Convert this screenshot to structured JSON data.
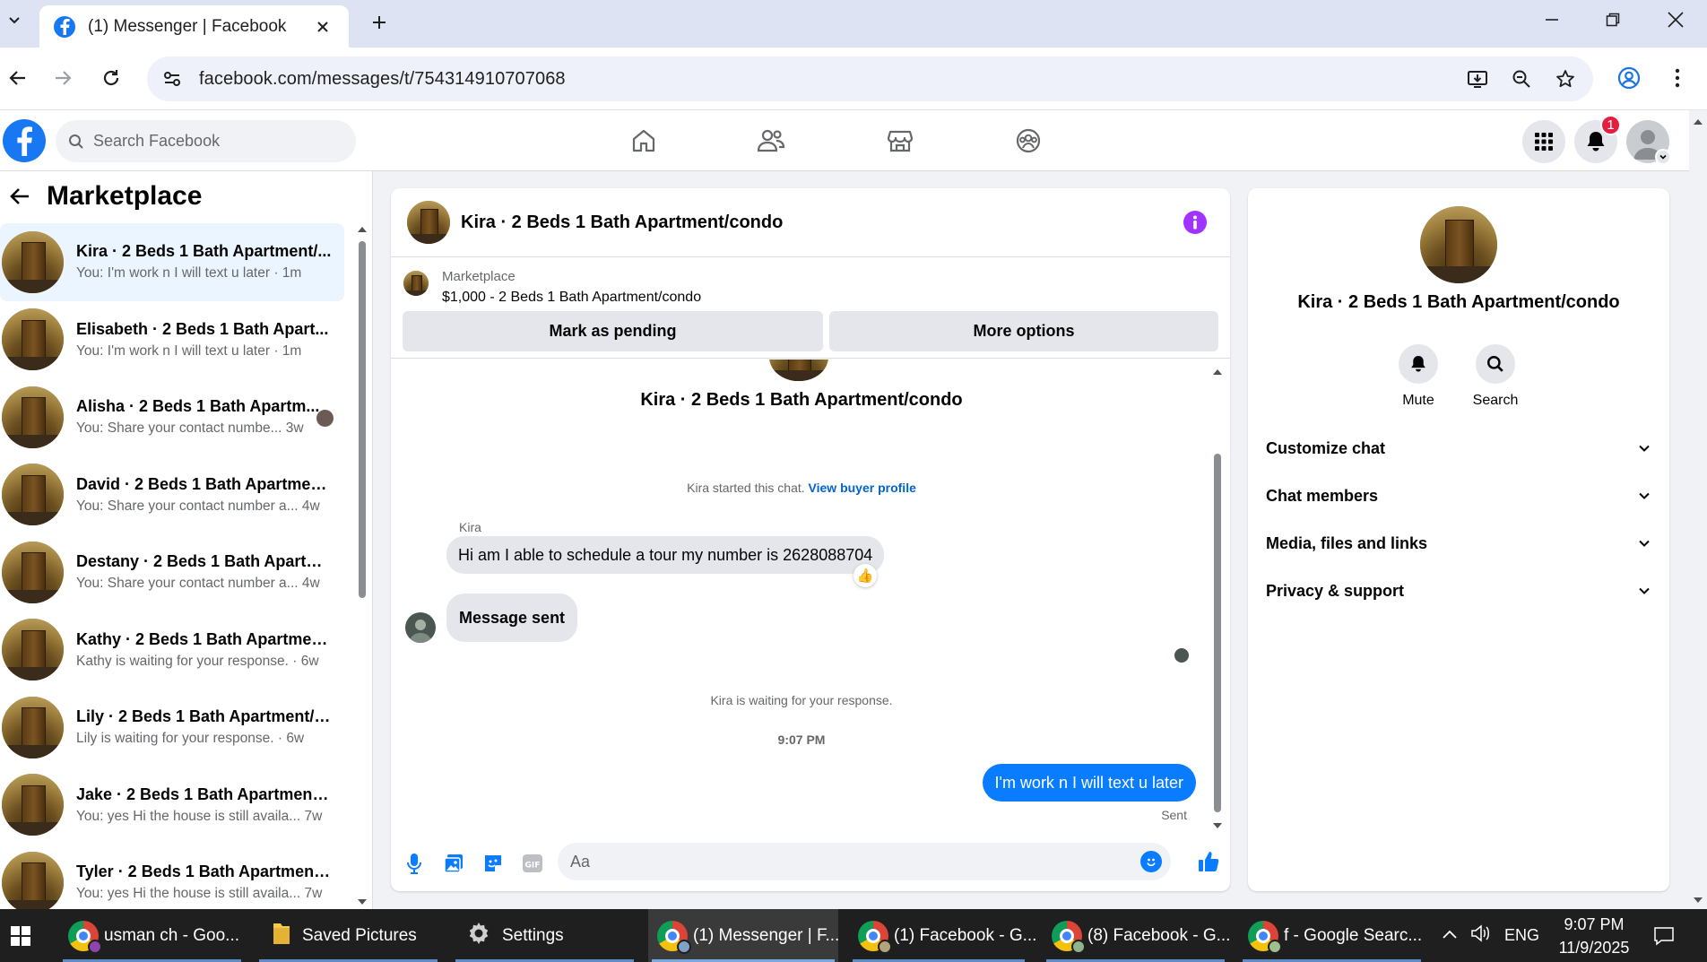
{
  "browser": {
    "tab_title": "(1) Messenger | Facebook",
    "url": "facebook.com/messages/t/754314910707068"
  },
  "facebook_header": {
    "search_placeholder": "Search Facebook",
    "notification_count": "1",
    "brand_color": "#1877f2"
  },
  "sidebar": {
    "title": "Marketplace",
    "conversations": [
      {
        "name": "Kira · 2 Beds 1 Bath Apartment/...",
        "preview": "You: I'm work n I will text u later · 1m",
        "active": true
      },
      {
        "name": "Elisabeth · 2 Beds 1 Bath Apart...",
        "preview": "You: I'm work n I will text u later · 1m"
      },
      {
        "name": "Alisha · 2 Beds 1 Bath Apartm...",
        "preview": "You: Share your contact numbe...  3w"
      },
      {
        "name": "David · 2 Beds 1 Bath Apartmen...",
        "preview": "You: Share your contact number a...  4w"
      },
      {
        "name": "Destany · 2 Beds 1 Bath Apartm...",
        "preview": "You: Share your contact number a...  4w"
      },
      {
        "name": "Kathy · 2 Beds 1 Bath Apartmen...",
        "preview": "Kathy is waiting for your response. · 6w"
      },
      {
        "name": "Lily · 2 Beds 1 Bath Apartment/c...",
        "preview": "Lily is waiting for your response. · 6w"
      },
      {
        "name": "Jake · 2 Beds 1 Bath Apartment/...",
        "preview": "You: yes Hi the house is still availa...  7w"
      },
      {
        "name": "Tyler · 2 Beds 1 Bath Apartment...",
        "preview": "You: yes Hi the house is still availa...  7w"
      }
    ]
  },
  "chat": {
    "title": "Kira · 2 Beds 1 Bath Apartment/condo",
    "marketplace_label": "Marketplace",
    "listing": "$1,000 - 2 Beds 1 Bath Apartment/condo",
    "mark_pending": "Mark as pending",
    "more_options": "More options",
    "intro_title": "Kira · 2 Beds 1 Bath Apartment/condo",
    "started_text": "Kira started this chat.",
    "view_buyer_profile": "View buyer profile",
    "sender_name": "Kira",
    "messages": [
      {
        "from": "Kira",
        "text": "Hi am I able to schedule a tour my number is 2628088704",
        "reaction": "👍"
      },
      {
        "from": "Kira",
        "text": "Message sent"
      },
      {
        "from": "me",
        "text": "I'm work n I will text u later"
      }
    ],
    "waiting_text": "Kira is waiting for your response.",
    "timestamp": "9:07 PM",
    "sent_status": "Sent",
    "composer_placeholder": "Aa",
    "outgoing_color": "#0a7cff"
  },
  "right_panel": {
    "name": "Kira · 2 Beds 1 Bath Apartment/condo",
    "actions": [
      "Mute",
      "Search"
    ],
    "sections": [
      "Customize chat",
      "Chat members",
      "Media, files and links",
      "Privacy & support"
    ]
  },
  "taskbar": {
    "items": [
      {
        "label": "usman ch - Goo...",
        "icon": "chrome-icon"
      },
      {
        "label": "Saved Pictures",
        "icon": "folder-icon"
      },
      {
        "label": "Settings",
        "icon": "gear-icon"
      },
      {
        "label": "(1) Messenger | F...",
        "icon": "chrome-icon",
        "active": true
      },
      {
        "label": "(1) Facebook - G...",
        "icon": "chrome-icon"
      },
      {
        "label": "(8) Facebook - G...",
        "icon": "chrome-icon"
      },
      {
        "label": "f - Google Searc...",
        "icon": "chrome-icon"
      }
    ],
    "language": "ENG",
    "time": "9:07 PM",
    "date": "11/9/2025"
  }
}
